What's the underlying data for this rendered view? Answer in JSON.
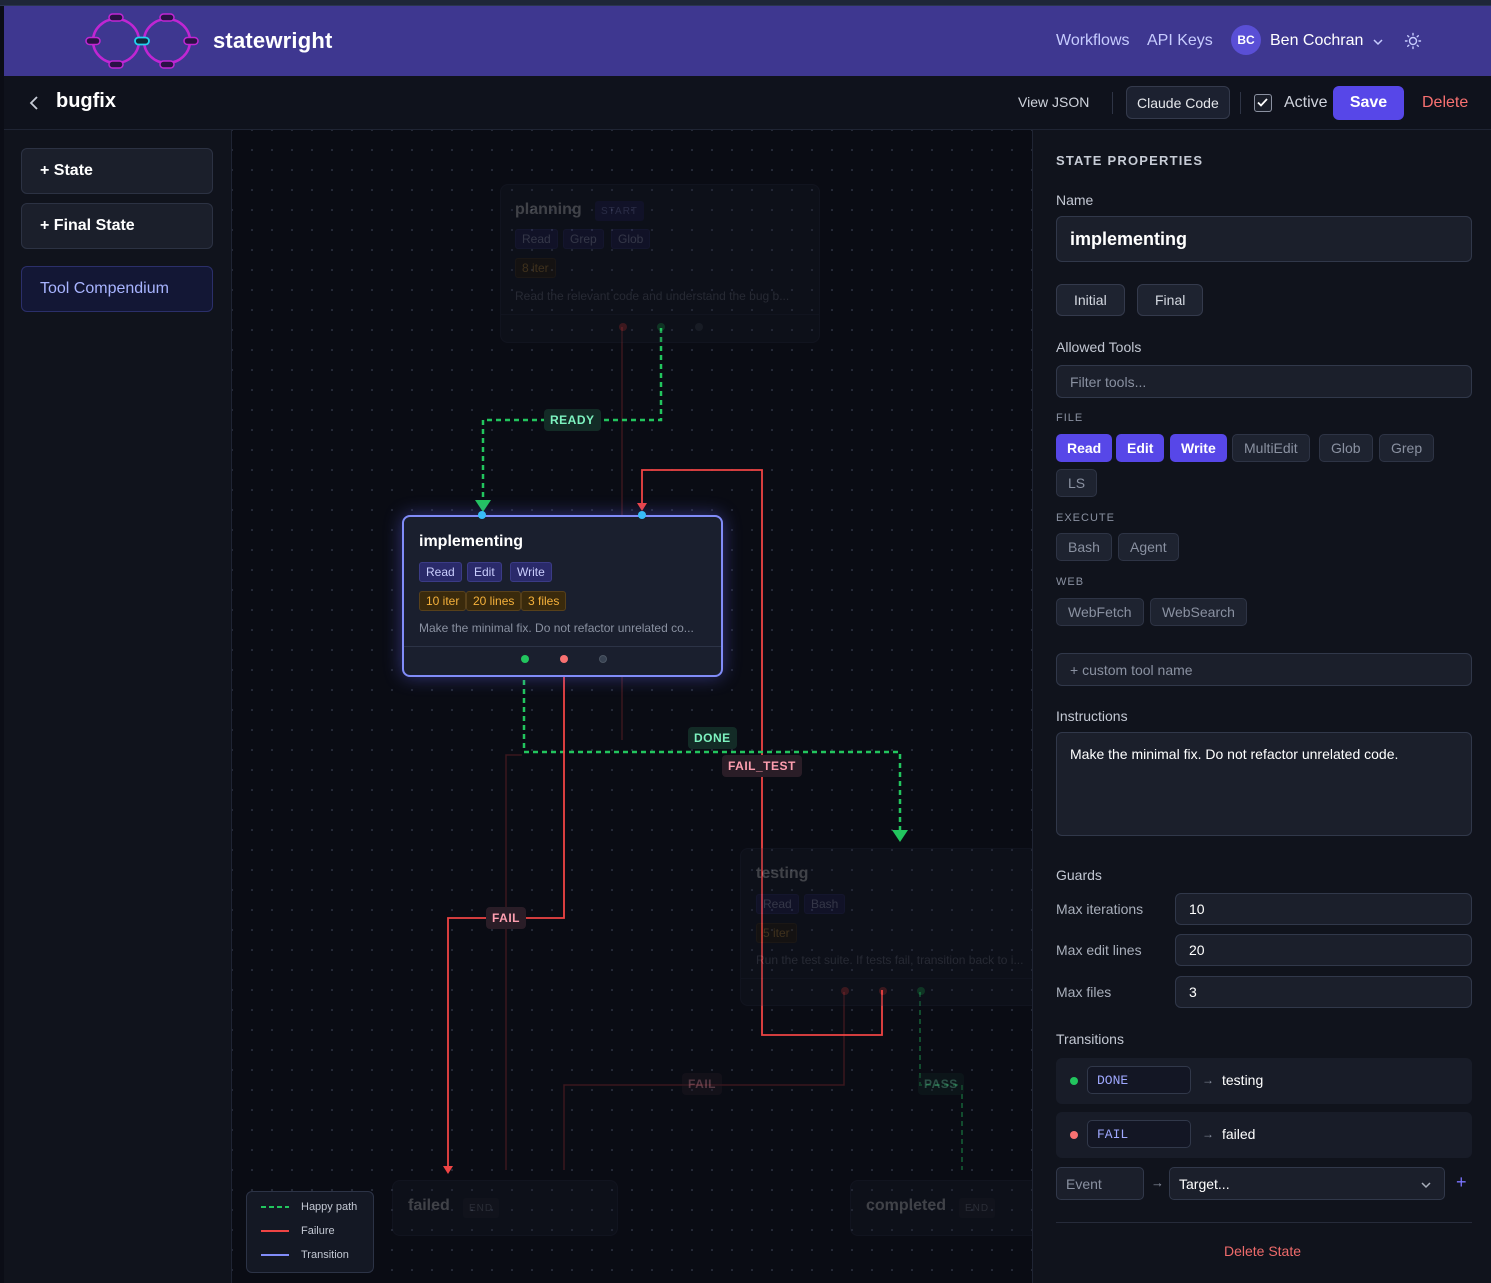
{
  "app": {
    "brand": "statewright",
    "nav": [
      "Workflows",
      "API Keys"
    ],
    "user": {
      "initials": "BC",
      "name": "Ben Cochran"
    }
  },
  "toolbar": {
    "workflow_title": "bugfix",
    "view_json": "View JSON",
    "claude_code": "Claude Code",
    "active_label": "Active",
    "active_checked": true,
    "save": "Save",
    "delete": "Delete"
  },
  "sidebar": {
    "add_state": "+ State",
    "add_final_state": "+ Final State",
    "tool_compendium": "Tool Compendium"
  },
  "canvas": {
    "nodes": {
      "planning": {
        "name": "planning",
        "badge": "START",
        "tools": [
          "Read",
          "Grep",
          "Glob"
        ],
        "guards": [
          "8 iter"
        ],
        "desc": "Read the relevant code and understand the bug b..."
      },
      "implementing": {
        "name": "implementing",
        "tools": [
          "Read",
          "Edit",
          "Write"
        ],
        "guards": [
          "10 iter",
          "20 lines",
          "3 files"
        ],
        "desc": "Make the minimal fix. Do not refactor unrelated co..."
      },
      "testing": {
        "name": "testing",
        "tools": [
          "Read",
          "Bash"
        ],
        "guards": [
          "5 iter"
        ],
        "desc": "Run the test suite. If tests fail, transition back to i..."
      },
      "failed": {
        "name": "failed",
        "badge": "END"
      },
      "completed": {
        "name": "completed",
        "badge": "END"
      }
    },
    "edge_labels": {
      "ready": "READY",
      "done": "DONE",
      "fail_test": "FAIL_TEST",
      "fail": "FAIL",
      "fail_dim": "FAIL",
      "pass": "PASS"
    },
    "legend": [
      {
        "label": "Happy path",
        "color": "#22c55e"
      },
      {
        "label": "Failure",
        "color": "#ef4444"
      },
      {
        "label": "Transition",
        "color": "#818cf8"
      }
    ]
  },
  "panel": {
    "heading": "STATE PROPERTIES",
    "name_label": "Name",
    "name_value": "implementing",
    "initial_btn": "Initial",
    "final_btn": "Final",
    "allowed_tools_label": "Allowed Tools",
    "filter_placeholder": "Filter tools...",
    "categories": {
      "file": {
        "label": "FILE",
        "tools": [
          {
            "name": "Read",
            "on": true
          },
          {
            "name": "Edit",
            "on": true
          },
          {
            "name": "Write",
            "on": true
          },
          {
            "name": "MultiEdit",
            "on": false
          },
          {
            "name": "Glob",
            "on": false
          },
          {
            "name": "Grep",
            "on": false
          },
          {
            "name": "LS",
            "on": false
          }
        ]
      },
      "execute": {
        "label": "EXECUTE",
        "tools": [
          {
            "name": "Bash",
            "on": false
          },
          {
            "name": "Agent",
            "on": false
          }
        ]
      },
      "web": {
        "label": "WEB",
        "tools": [
          {
            "name": "WebFetch",
            "on": false
          },
          {
            "name": "WebSearch",
            "on": false
          }
        ]
      }
    },
    "custom_tool_placeholder": "+ custom tool name",
    "instructions_label": "Instructions",
    "instructions": "Make the minimal fix. Do not refactor unrelated code.",
    "guards_label": "Guards",
    "guards": [
      {
        "label": "Max iterations",
        "value": "10"
      },
      {
        "label": "Max edit lines",
        "value": "20"
      },
      {
        "label": "Max files",
        "value": "3"
      }
    ],
    "transitions_label": "Transitions",
    "transitions": [
      {
        "event": "DONE",
        "target": "testing",
        "color": "#22c55e"
      },
      {
        "event": "FAIL",
        "target": "failed",
        "color": "#ef4444"
      }
    ],
    "new_event_placeholder": "Event",
    "new_target_placeholder": "Target...",
    "add_symbol": "+",
    "delete_state": "Delete State"
  }
}
